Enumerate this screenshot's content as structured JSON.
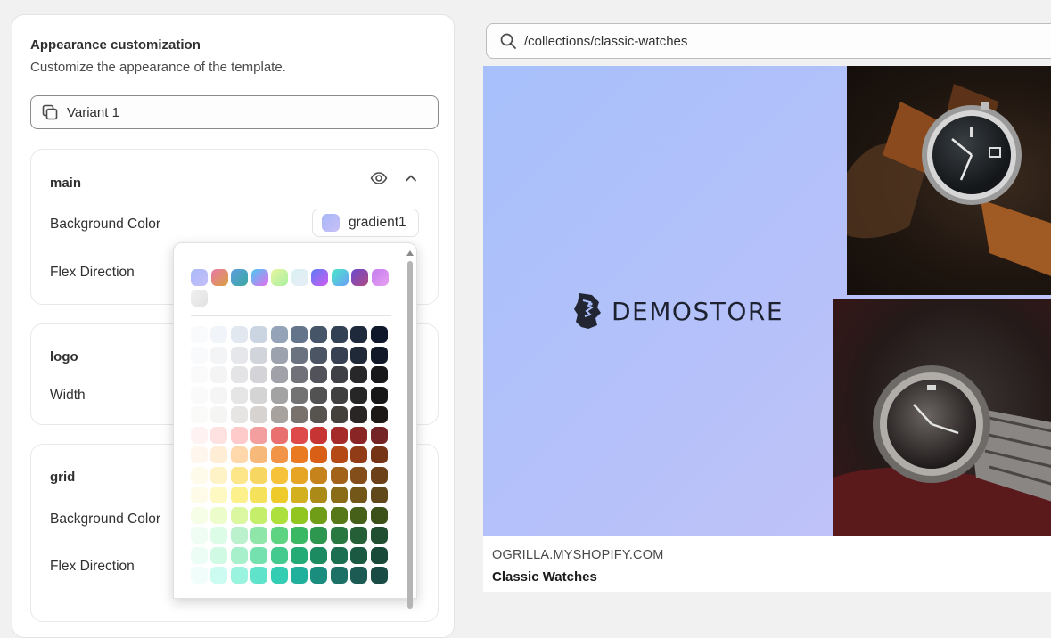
{
  "panel": {
    "title": "Appearance customization",
    "subtitle": "Customize the appearance of the template.",
    "variant_label": "Variant 1"
  },
  "sections": {
    "main": {
      "title": "main",
      "rows": [
        "Background Color",
        "Flex Direction"
      ],
      "background_value": "gradient1"
    },
    "logo": {
      "title": "logo",
      "rows": [
        "Width"
      ]
    },
    "grid": {
      "title": "grid",
      "rows": [
        "Background Color",
        "Flex Direction"
      ]
    }
  },
  "color_picker": {
    "gradients": [
      [
        "#aab8f8",
        "#c4c0f8"
      ],
      [
        "#e879a8",
        "#d9a03f"
      ],
      [
        "#5e9ee0",
        "#3aa8a0"
      ],
      [
        "#48c9f0",
        "#e86df0"
      ],
      [
        "#e8f5a0",
        "#a8f0a0"
      ],
      [
        "#d8f0f0",
        "#e8eef8"
      ],
      [
        "#5b7cf6",
        "#d05bf0"
      ],
      [
        "#4ae8c8",
        "#6b9ef8"
      ],
      [
        "#6a4ad0",
        "#b04a80"
      ],
      [
        "#c47cf0",
        "#e8a0f0"
      ],
      [
        "#f0f0f0",
        "#e2e2e2"
      ]
    ],
    "swatches": [
      [
        "#f8fafc",
        "#f1f5f9",
        "#e2e8f0",
        "#cbd5e1",
        "#94a3b8",
        "#64748b",
        "#475569",
        "#334155",
        "#1e293b",
        "#0f172a"
      ],
      [
        "#f9fafb",
        "#f3f4f6",
        "#e5e7eb",
        "#d1d5db",
        "#9ca3af",
        "#6b7280",
        "#4b5563",
        "#374151",
        "#1f2937",
        "#111827"
      ],
      [
        "#fafafa",
        "#f4f4f5",
        "#e4e4e7",
        "#d4d4d8",
        "#a1a1aa",
        "#71717a",
        "#52525b",
        "#3f3f46",
        "#27272a",
        "#18181b"
      ],
      [
        "#fafafa",
        "#f5f5f5",
        "#e5e5e5",
        "#d4d4d4",
        "#a3a3a3",
        "#737373",
        "#525252",
        "#404040",
        "#262626",
        "#171717"
      ],
      [
        "#fafaf9",
        "#f5f5f4",
        "#e7e5e4",
        "#d6d3d1",
        "#a8a29e",
        "#78716c",
        "#57534e",
        "#44403c",
        "#292524",
        "#1c1917"
      ],
      [
        "#fef2f2",
        "#fee2e2",
        "#fecaca",
        "#f39f9f",
        "#ea6f6f",
        "#de4a4a",
        "#c73434",
        "#a52a2a",
        "#8a2525",
        "#742424"
      ],
      [
        "#fff7ed",
        "#ffedd5",
        "#fed7aa",
        "#f7b97a",
        "#f19447",
        "#ea7a22",
        "#d95f16",
        "#b44915",
        "#913c17",
        "#763416"
      ],
      [
        "#fffbeb",
        "#fef3c7",
        "#fde68a",
        "#f8d662",
        "#f5c23a",
        "#e6a524",
        "#c7831b",
        "#a3621a",
        "#834e1a",
        "#6c4119"
      ],
      [
        "#fefce8",
        "#fef9c3",
        "#fbf08a",
        "#f5e15a",
        "#eecb2a",
        "#d3b01e",
        "#ab8a17",
        "#8a6b18",
        "#725719",
        "#61481a"
      ],
      [
        "#f7fee7",
        "#ecfccb",
        "#dbf7a0",
        "#c5ee6a",
        "#aee03d",
        "#90c61f",
        "#6f9d17",
        "#567818",
        "#465f19",
        "#3c511a"
      ],
      [
        "#f0fdf4",
        "#dcfce7",
        "#bbf2cd",
        "#8ee6a9",
        "#5ed381",
        "#3bb864",
        "#2e974f",
        "#297842",
        "#255f38",
        "#214e31"
      ],
      [
        "#ecfdf5",
        "#d1fae5",
        "#a7f0cb",
        "#74e1ae",
        "#44ca8e",
        "#25ac76",
        "#1d8b61",
        "#1c6f50",
        "#1b5943",
        "#194a39"
      ],
      [
        "#f0fdfa",
        "#ccfbf1",
        "#99f3df",
        "#5fe4cb",
        "#33cdb4",
        "#21b09b",
        "#1b8d7f",
        "#1c7066",
        "#1b5b53",
        "#1a4b45"
      ]
    ]
  },
  "preview": {
    "url": "/collections/classic-watches",
    "logo_text": "DEMOSTORE",
    "domain": "OGRILLA.MYSHOPIFY.COM",
    "title": "Classic Watches"
  }
}
